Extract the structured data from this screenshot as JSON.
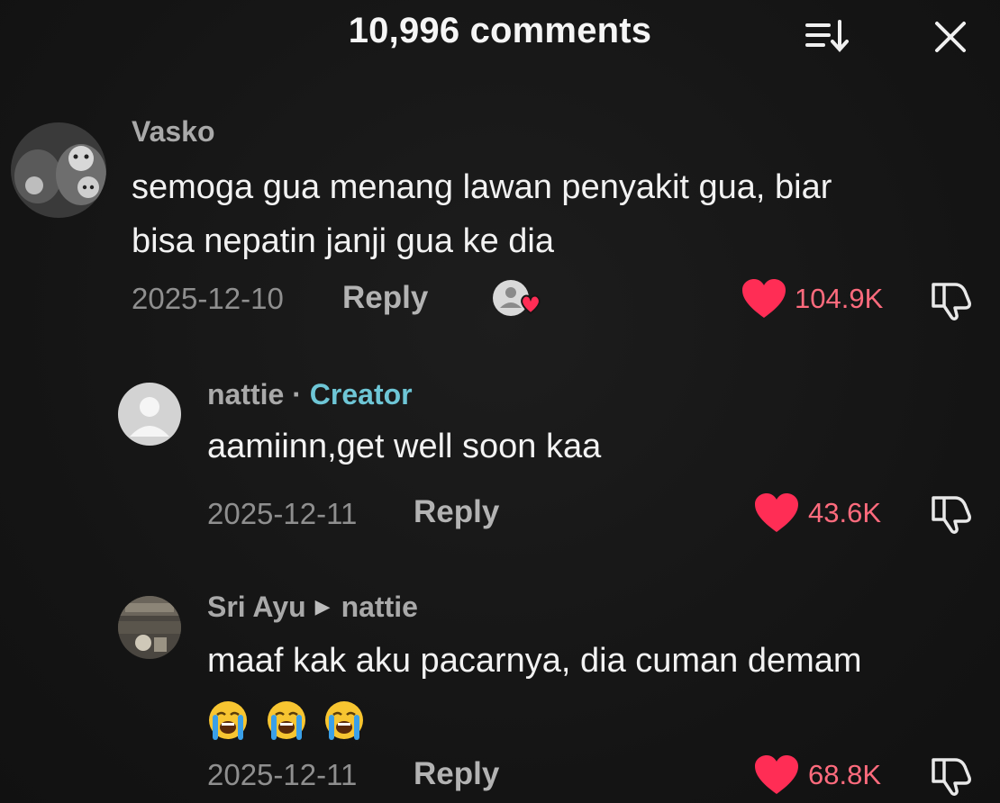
{
  "header": {
    "title": "10,996 comments"
  },
  "comments": [
    {
      "username": "Vasko",
      "lines": [
        "semoga gua menang lawan penyakit gua, biar",
        "bisa nepatin janji gua ke dia"
      ],
      "date": "2025-12-10",
      "reply_label": "Reply",
      "likes": "104.9K"
    },
    {
      "username": "nattie",
      "separator": "·",
      "tag": "Creator",
      "lines": [
        "aamiinn,get well soon kaa"
      ],
      "date": "2025-12-11",
      "reply_label": "Reply",
      "likes": "43.6K"
    },
    {
      "username": "Sri Ayu",
      "reply_to": "nattie",
      "lines": [
        "maaf kak aku pacarnya, dia cuman demam"
      ],
      "emojis": [
        "loudly-crying-face",
        "loudly-crying-face",
        "loudly-crying-face"
      ],
      "date": "2025-12-11",
      "reply_label": "Reply",
      "likes": "68.8K"
    }
  ],
  "colors": {
    "background": "#161616",
    "like": "#ff2d55",
    "like_count": "#ff6b7d",
    "creator_tag": "#6ec6d6"
  }
}
